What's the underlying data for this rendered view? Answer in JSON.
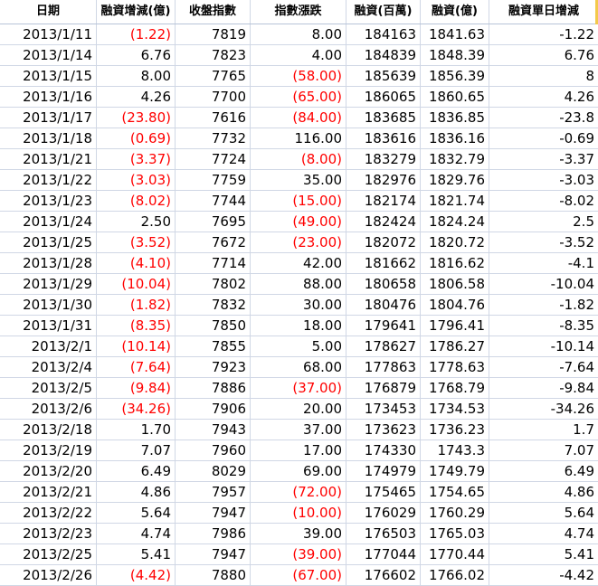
{
  "headers": [
    "日期",
    "融資增減(億)",
    "收盤指數",
    "指數漲跌",
    "融資(百萬)",
    "融資(億)",
    "融資單日增減"
  ],
  "rows": [
    [
      "2013/1/11",
      "(1.22)",
      "7819",
      "8.00",
      "184163",
      "1841.63",
      "-1.22"
    ],
    [
      "2013/1/14",
      "6.76",
      "7823",
      "4.00",
      "184839",
      "1848.39",
      "6.76"
    ],
    [
      "2013/1/15",
      "8.00",
      "7765",
      "(58.00)",
      "185639",
      "1856.39",
      "8"
    ],
    [
      "2013/1/16",
      "4.26",
      "7700",
      "(65.00)",
      "186065",
      "1860.65",
      "4.26"
    ],
    [
      "2013/1/17",
      "(23.80)",
      "7616",
      "(84.00)",
      "183685",
      "1836.85",
      "-23.8"
    ],
    [
      "2013/1/18",
      "(0.69)",
      "7732",
      "116.00",
      "183616",
      "1836.16",
      "-0.69"
    ],
    [
      "2013/1/21",
      "(3.37)",
      "7724",
      "(8.00)",
      "183279",
      "1832.79",
      "-3.37"
    ],
    [
      "2013/1/22",
      "(3.03)",
      "7759",
      "35.00",
      "182976",
      "1829.76",
      "-3.03"
    ],
    [
      "2013/1/23",
      "(8.02)",
      "7744",
      "(15.00)",
      "182174",
      "1821.74",
      "-8.02"
    ],
    [
      "2013/1/24",
      "2.50",
      "7695",
      "(49.00)",
      "182424",
      "1824.24",
      "2.5"
    ],
    [
      "2013/1/25",
      "(3.52)",
      "7672",
      "(23.00)",
      "182072",
      "1820.72",
      "-3.52"
    ],
    [
      "2013/1/28",
      "(4.10)",
      "7714",
      "42.00",
      "181662",
      "1816.62",
      "-4.1"
    ],
    [
      "2013/1/29",
      "(10.04)",
      "7802",
      "88.00",
      "180658",
      "1806.58",
      "-10.04"
    ],
    [
      "2013/1/30",
      "(1.82)",
      "7832",
      "30.00",
      "180476",
      "1804.76",
      "-1.82"
    ],
    [
      "2013/1/31",
      "(8.35)",
      "7850",
      "18.00",
      "179641",
      "1796.41",
      "-8.35"
    ],
    [
      "2013/2/1",
      "(10.14)",
      "7855",
      "5.00",
      "178627",
      "1786.27",
      "-10.14"
    ],
    [
      "2013/2/4",
      "(7.64)",
      "7923",
      "68.00",
      "177863",
      "1778.63",
      "-7.64"
    ],
    [
      "2013/2/5",
      "(9.84)",
      "7886",
      "(37.00)",
      "176879",
      "1768.79",
      "-9.84"
    ],
    [
      "2013/2/6",
      "(34.26)",
      "7906",
      "20.00",
      "173453",
      "1734.53",
      "-34.26"
    ],
    [
      "2013/2/18",
      "1.70",
      "7943",
      "37.00",
      "173623",
      "1736.23",
      "1.7"
    ],
    [
      "2013/2/19",
      "7.07",
      "7960",
      "17.00",
      "174330",
      "1743.3",
      "7.07"
    ],
    [
      "2013/2/20",
      "6.49",
      "8029",
      "69.00",
      "174979",
      "1749.79",
      "6.49"
    ],
    [
      "2013/2/21",
      "4.86",
      "7957",
      "(72.00)",
      "175465",
      "1754.65",
      "4.86"
    ],
    [
      "2013/2/22",
      "5.64",
      "7947",
      "(10.00)",
      "176029",
      "1760.29",
      "5.64"
    ],
    [
      "2013/2/23",
      "4.74",
      "7986",
      "39.00",
      "176503",
      "1765.03",
      "4.74"
    ],
    [
      "2013/2/25",
      "5.41",
      "7947",
      "(39.00)",
      "177044",
      "1770.44",
      "5.41"
    ],
    [
      "2013/2/26",
      "(4.42)",
      "7880",
      "(67.00)",
      "176602",
      "1766.02",
      "-4.42"
    ]
  ],
  "colors": {
    "negative_text": "#ff0000",
    "text": "#000000",
    "gridline": "#d0d7e5",
    "accent": "#f3c94a"
  }
}
